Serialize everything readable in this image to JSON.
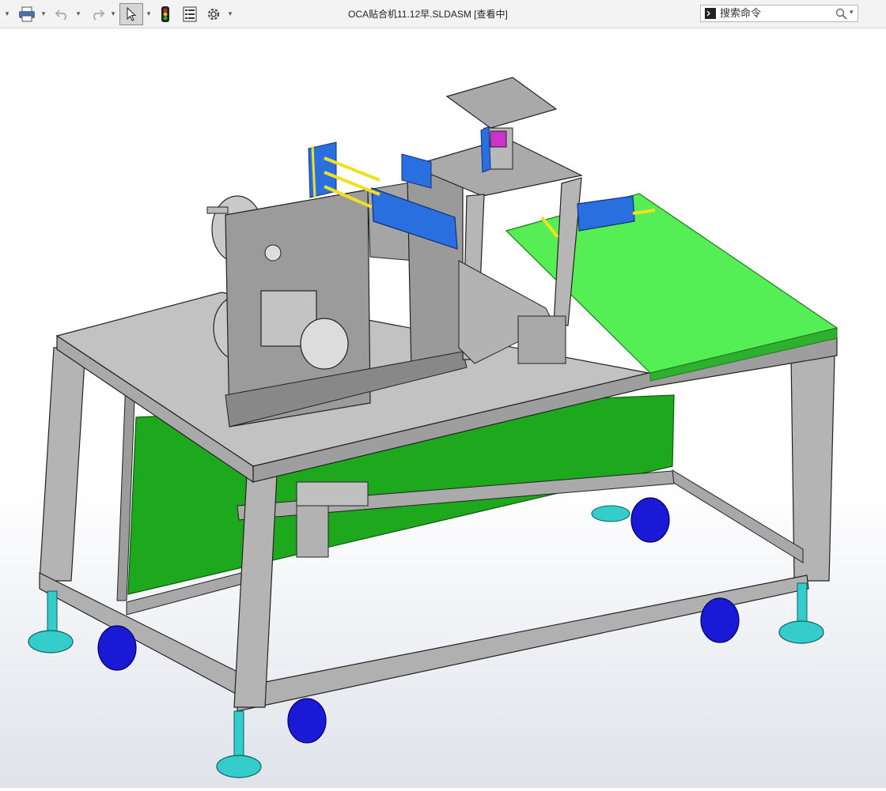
{
  "window": {
    "title": "OCA贴合机11.12早.SLDASM [查看中]"
  },
  "toolbar": {
    "items": [
      "print-icon",
      "undo-icon",
      "redo-icon",
      "select-icon",
      "rebuild-icon",
      "file-properties-icon",
      "options-icon"
    ]
  },
  "search": {
    "placeholder": "搜索命令"
  },
  "view_toolbar": {
    "items": [
      "zoom-to-fit-icon",
      "zoom-to-area-icon",
      "previous-view-icon",
      "section-view-icon",
      "view-orientation-icon",
      "display-style-icon",
      "hide-show-items-icon",
      "edit-appearance-icon",
      "apply-scene-icon",
      "view-settings-icon"
    ]
  },
  "model": {
    "frame_color": "#b4b4b4",
    "panel_color": "#1ea81e",
    "plate_color": "#55ee55",
    "caster_color": "#1a1ad6",
    "leveler_color": "#35cccc",
    "actuator_color": "#2a6fe0",
    "rod_color": "#f0e020"
  }
}
